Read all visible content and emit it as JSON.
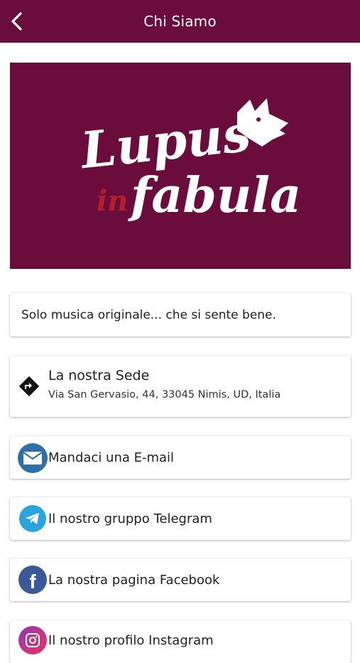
{
  "header": {
    "title": "Chi Siamo"
  },
  "logo": {
    "text_top": "Lupus",
    "text_mid": "in",
    "text_bottom": "fabula"
  },
  "tagline": "Solo musica originale... che si sente bene.",
  "address": {
    "title": "La nostra Sede",
    "value": "Via San Gervasio, 44, 33045 Nimis, UD, Italia"
  },
  "links": {
    "email": "Mandaci una E-mail",
    "telegram": "Il nostro gruppo Telegram",
    "facebook": "La nostra pagina Facebook",
    "instagram": "Il nostro profilo Instagram"
  },
  "colors": {
    "brand": "#6a0c3c",
    "email": "#2d6fa8",
    "telegram": "#2aa3de",
    "facebook": "#3b5998",
    "instagram": "#c13584"
  }
}
